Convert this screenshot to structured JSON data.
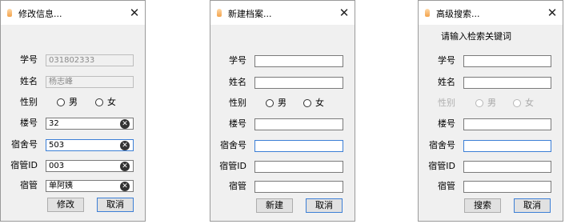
{
  "edit_dialog": {
    "title": "修改信息...",
    "close_glyph": "✕",
    "labels": {
      "student_id": "学号",
      "name": "姓名",
      "gender": "性别",
      "building": "楼号",
      "room": "宿舍号",
      "manager_id": "宿管ID",
      "manager": "宿管"
    },
    "values": {
      "student_id": "031802333",
      "name": "杨志峰",
      "building": "32",
      "room": "503",
      "manager_id": "003",
      "manager": "单阿姨"
    },
    "gender_options": [
      "男",
      "女"
    ],
    "clear_glyph": "✕",
    "buttons": {
      "submit": "修改",
      "cancel": "取消"
    }
  },
  "new_dialog": {
    "title": "新建档案...",
    "close_glyph": "✕",
    "labels": {
      "student_id": "学号",
      "name": "姓名",
      "gender": "性别",
      "building": "楼号",
      "room": "宿舍号",
      "manager_id": "宿管ID",
      "manager": "宿管"
    },
    "gender_options": [
      "男",
      "女"
    ],
    "buttons": {
      "submit": "新建",
      "cancel": "取消"
    }
  },
  "search_dialog": {
    "title": "高级搜索...",
    "close_glyph": "✕",
    "hint": "请输入检索关键词",
    "labels": {
      "student_id": "学号",
      "name": "姓名",
      "gender": "性别",
      "building": "楼号",
      "room": "宿舍号",
      "manager_id": "宿管ID",
      "manager": "宿管"
    },
    "gender_options": [
      "男",
      "女"
    ],
    "buttons": {
      "submit": "搜索",
      "cancel": "取消"
    }
  }
}
